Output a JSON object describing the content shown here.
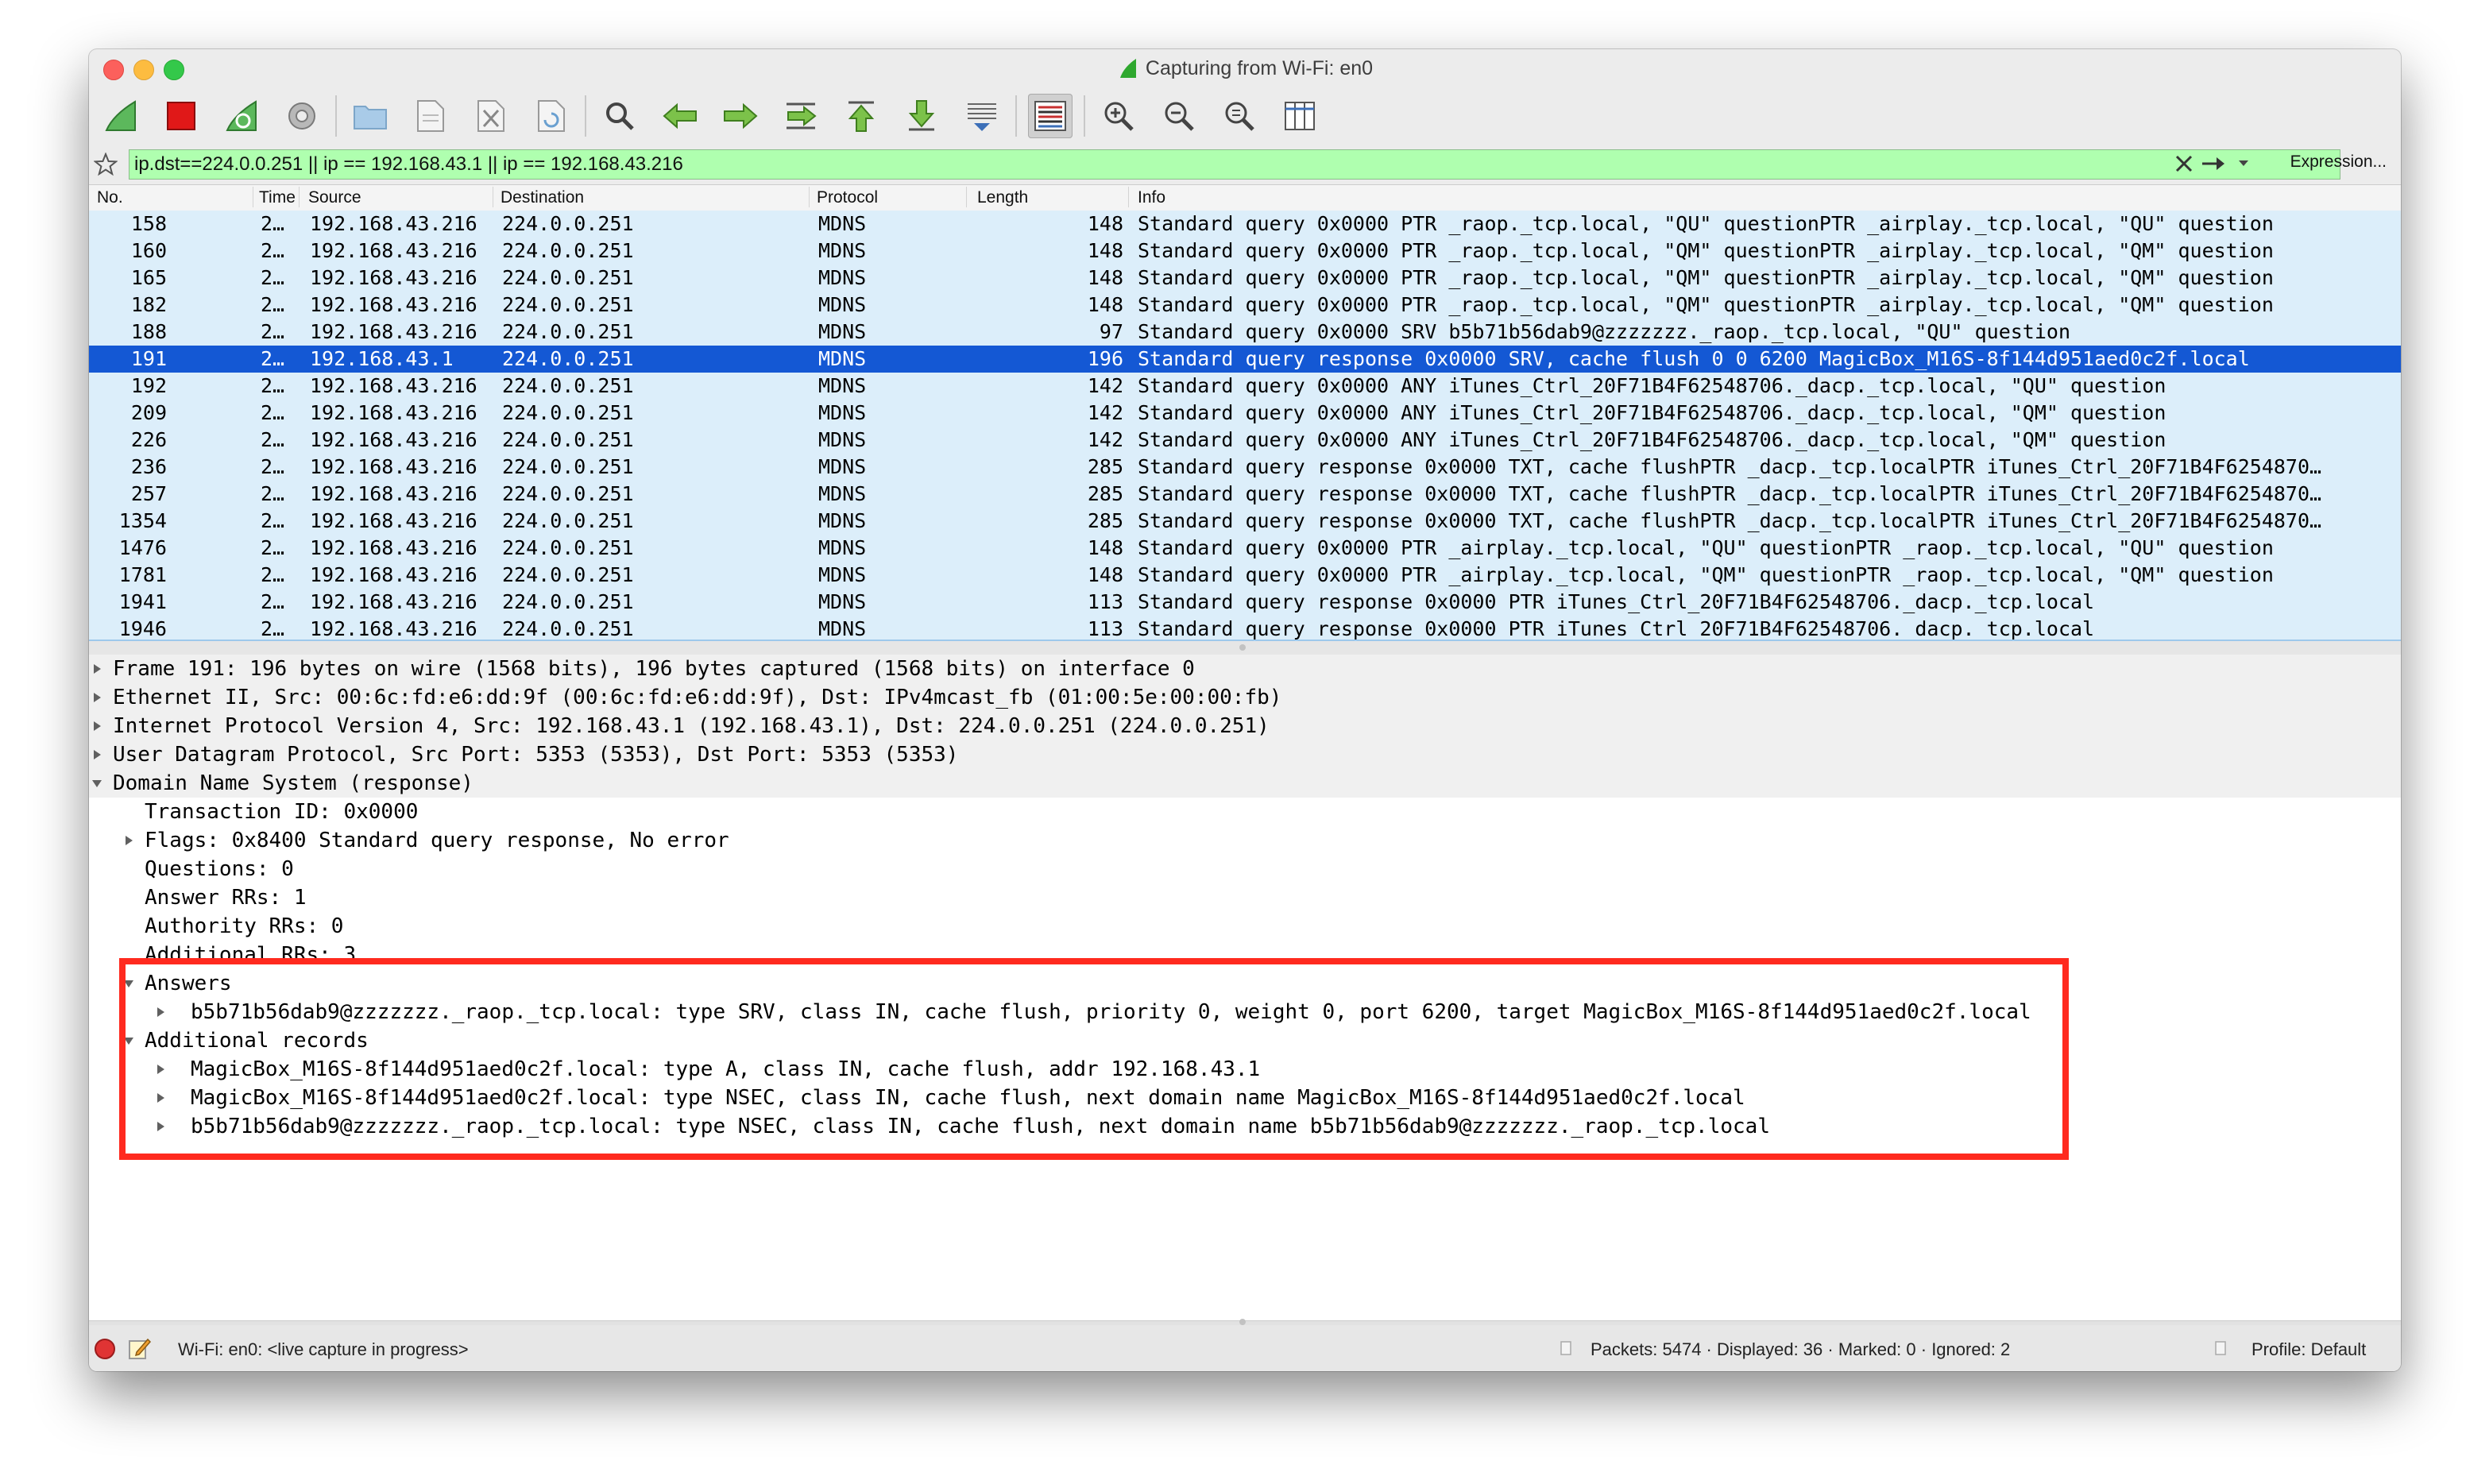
{
  "window": {
    "title": "Capturing from Wi-Fi: en0"
  },
  "toolbar": {
    "buttons": [
      "start-capture",
      "stop-capture",
      "restart-capture",
      "capture-options",
      "open-file",
      "save-file",
      "close-file",
      "reload-file",
      "find-packet",
      "go-back",
      "go-forward",
      "go-to-packet",
      "go-first-packet",
      "go-last-packet",
      "auto-scroll",
      "colorize",
      "zoom-in",
      "zoom-out",
      "normal-size",
      "resize-columns"
    ]
  },
  "filter": {
    "value": "ip.dst==224.0.0.251 || ip == 192.168.43.1 || ip == 192.168.43.216",
    "expression_label": "Expression..."
  },
  "packet_list": {
    "columns": {
      "no": "No.",
      "time": "Time",
      "source": "Source",
      "destination": "Destination",
      "protocol": "Protocol",
      "length": "Length",
      "info": "Info"
    },
    "rows": [
      {
        "no": "158",
        "time": "2…",
        "source": "192.168.43.216",
        "destination": "224.0.0.251",
        "protocol": "MDNS",
        "length": "148",
        "info": "Standard query 0x0000 PTR _raop._tcp.local, \"QU\" questionPTR _airplay._tcp.local, \"QU\" question"
      },
      {
        "no": "160",
        "time": "2…",
        "source": "192.168.43.216",
        "destination": "224.0.0.251",
        "protocol": "MDNS",
        "length": "148",
        "info": "Standard query 0x0000 PTR _raop._tcp.local, \"QM\" questionPTR _airplay._tcp.local, \"QM\" question"
      },
      {
        "no": "165",
        "time": "2…",
        "source": "192.168.43.216",
        "destination": "224.0.0.251",
        "protocol": "MDNS",
        "length": "148",
        "info": "Standard query 0x0000 PTR _raop._tcp.local, \"QM\" questionPTR _airplay._tcp.local, \"QM\" question"
      },
      {
        "no": "182",
        "time": "2…",
        "source": "192.168.43.216",
        "destination": "224.0.0.251",
        "protocol": "MDNS",
        "length": "148",
        "info": "Standard query 0x0000 PTR _raop._tcp.local, \"QM\" questionPTR _airplay._tcp.local, \"QM\" question"
      },
      {
        "no": "188",
        "time": "2…",
        "source": "192.168.43.216",
        "destination": "224.0.0.251",
        "protocol": "MDNS",
        "length": "97",
        "info": "Standard query 0x0000 SRV b5b71b56dab9@zzzzzzz._raop._tcp.local, \"QU\" question"
      },
      {
        "no": "191",
        "time": "2…",
        "source": "192.168.43.1",
        "destination": "224.0.0.251",
        "protocol": "MDNS",
        "length": "196",
        "info": "Standard query response 0x0000 SRV, cache flush 0 0 6200 MagicBox_M16S-8f144d951aed0c2f.local",
        "selected": true
      },
      {
        "no": "192",
        "time": "2…",
        "source": "192.168.43.216",
        "destination": "224.0.0.251",
        "protocol": "MDNS",
        "length": "142",
        "info": "Standard query 0x0000 ANY iTunes_Ctrl_20F71B4F62548706._dacp._tcp.local, \"QU\" question"
      },
      {
        "no": "209",
        "time": "2…",
        "source": "192.168.43.216",
        "destination": "224.0.0.251",
        "protocol": "MDNS",
        "length": "142",
        "info": "Standard query 0x0000 ANY iTunes_Ctrl_20F71B4F62548706._dacp._tcp.local, \"QM\" question"
      },
      {
        "no": "226",
        "time": "2…",
        "source": "192.168.43.216",
        "destination": "224.0.0.251",
        "protocol": "MDNS",
        "length": "142",
        "info": "Standard query 0x0000 ANY iTunes_Ctrl_20F71B4F62548706._dacp._tcp.local, \"QM\" question"
      },
      {
        "no": "236",
        "time": "2…",
        "source": "192.168.43.216",
        "destination": "224.0.0.251",
        "protocol": "MDNS",
        "length": "285",
        "info": "Standard query response 0x0000 TXT, cache flushPTR _dacp._tcp.localPTR iTunes_Ctrl_20F71B4F6254870…"
      },
      {
        "no": "257",
        "time": "2…",
        "source": "192.168.43.216",
        "destination": "224.0.0.251",
        "protocol": "MDNS",
        "length": "285",
        "info": "Standard query response 0x0000 TXT, cache flushPTR _dacp._tcp.localPTR iTunes_Ctrl_20F71B4F6254870…"
      },
      {
        "no": "1354",
        "time": "2…",
        "source": "192.168.43.216",
        "destination": "224.0.0.251",
        "protocol": "MDNS",
        "length": "285",
        "info": "Standard query response 0x0000 TXT, cache flushPTR _dacp._tcp.localPTR iTunes_Ctrl_20F71B4F6254870…"
      },
      {
        "no": "1476",
        "time": "2…",
        "source": "192.168.43.216",
        "destination": "224.0.0.251",
        "protocol": "MDNS",
        "length": "148",
        "info": "Standard query 0x0000 PTR _airplay._tcp.local, \"QU\" questionPTR _raop._tcp.local, \"QU\" question"
      },
      {
        "no": "1781",
        "time": "2…",
        "source": "192.168.43.216",
        "destination": "224.0.0.251",
        "protocol": "MDNS",
        "length": "148",
        "info": "Standard query 0x0000 PTR _airplay._tcp.local, \"QM\" questionPTR _raop._tcp.local, \"QM\" question"
      },
      {
        "no": "1941",
        "time": "2…",
        "source": "192.168.43.216",
        "destination": "224.0.0.251",
        "protocol": "MDNS",
        "length": "113",
        "info": "Standard query response 0x0000 PTR iTunes_Ctrl_20F71B4F62548706._dacp._tcp.local"
      },
      {
        "no": "1946",
        "time": "2…",
        "source": "192.168.43.216",
        "destination": "224.0.0.251",
        "protocol": "MDNS",
        "length": "113",
        "info": "Standard query response 0x0000 PTR iTunes_Ctrl_20F71B4F62548706._dacp._tcp.local"
      }
    ]
  },
  "details": [
    {
      "depth": 0,
      "state": "collapsed",
      "text": "Frame 191: 196 bytes on wire (1568 bits), 196 bytes captured (1568 bits) on interface 0"
    },
    {
      "depth": 0,
      "state": "collapsed",
      "text": "Ethernet II, Src: 00:6c:fd:e6:dd:9f (00:6c:fd:e6:dd:9f), Dst: IPv4mcast_fb (01:00:5e:00:00:fb)"
    },
    {
      "depth": 0,
      "state": "collapsed",
      "text": "Internet Protocol Version 4, Src: 192.168.43.1 (192.168.43.1), Dst: 224.0.0.251 (224.0.0.251)"
    },
    {
      "depth": 0,
      "state": "collapsed",
      "text": "User Datagram Protocol, Src Port: 5353 (5353), Dst Port: 5353 (5353)"
    },
    {
      "depth": 0,
      "state": "expanded",
      "text": "Domain Name System (response)"
    },
    {
      "depth": 1,
      "state": "leaf",
      "text": "Transaction ID: 0x0000"
    },
    {
      "depth": 1,
      "state": "collapsed",
      "text": "Flags: 0x8400 Standard query response, No error"
    },
    {
      "depth": 1,
      "state": "leaf",
      "text": "Questions: 0"
    },
    {
      "depth": 1,
      "state": "leaf",
      "text": "Answer RRs: 1"
    },
    {
      "depth": 1,
      "state": "leaf",
      "text": "Authority RRs: 0"
    },
    {
      "depth": 1,
      "state": "leaf",
      "text": "Additional RRs: 3"
    },
    {
      "depth": 1,
      "state": "expanded",
      "text": "Answers"
    },
    {
      "depth": 2,
      "state": "collapsed",
      "text": "b5b71b56dab9@zzzzzzz._raop._tcp.local: type SRV, class IN, cache flush, priority 0, weight 0, port 6200, target MagicBox_M16S-8f144d951aed0c2f.local"
    },
    {
      "depth": 1,
      "state": "expanded",
      "text": "Additional records"
    },
    {
      "depth": 2,
      "state": "collapsed",
      "text": "MagicBox_M16S-8f144d951aed0c2f.local: type A, class IN, cache flush, addr 192.168.43.1"
    },
    {
      "depth": 2,
      "state": "collapsed",
      "text": "MagicBox_M16S-8f144d951aed0c2f.local: type NSEC, class IN, cache flush, next domain name MagicBox_M16S-8f144d951aed0c2f.local"
    },
    {
      "depth": 2,
      "state": "collapsed",
      "text": "b5b71b56dab9@zzzzzzz._raop._tcp.local: type NSEC, class IN, cache flush, next domain name b5b71b56dab9@zzzzzzz._raop._tcp.local"
    }
  ],
  "status": {
    "capture_label": "Wi-Fi: en0: <live capture in progress>",
    "packets": "Packets: 5474 · Displayed: 36 · Marked: 0 · Ignored: 2",
    "profile": "Profile: Default"
  },
  "colors": {
    "filter_valid": "#afffaf",
    "row_bg": "#dceefa",
    "selected_row": "#1458d4",
    "highlight_box": "#ff2a1f"
  }
}
